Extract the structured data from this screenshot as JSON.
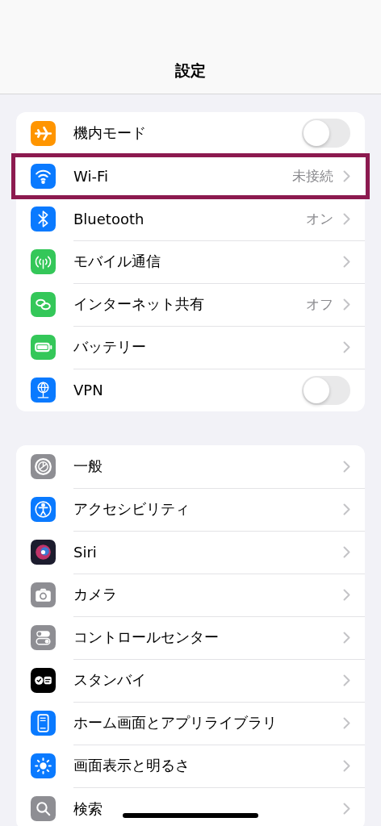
{
  "header": {
    "title": "設定"
  },
  "groups": [
    {
      "rows": [
        {
          "label": "機内モード",
          "kind": "toggle",
          "on": false,
          "highlighted": false,
          "color": "#ff9500"
        },
        {
          "label": "Wi-Fi",
          "kind": "link",
          "value": "未接続",
          "highlighted": true,
          "color": "#0a7aff"
        },
        {
          "label": "Bluetooth",
          "kind": "link",
          "value": "オン",
          "highlighted": false,
          "color": "#0a7aff"
        },
        {
          "label": "モバイル通信",
          "kind": "link",
          "highlighted": false,
          "color": "#34c759"
        },
        {
          "label": "インターネット共有",
          "kind": "link",
          "value": "オフ",
          "highlighted": false,
          "color": "#34c759"
        },
        {
          "label": "バッテリー",
          "kind": "link",
          "highlighted": false,
          "color": "#34c759"
        },
        {
          "label": "VPN",
          "kind": "toggle",
          "on": false,
          "highlighted": false,
          "color": "#0a7aff"
        }
      ]
    },
    {
      "rows": [
        {
          "label": "一般",
          "kind": "link",
          "highlighted": false,
          "color": "#8e8e93"
        },
        {
          "label": "アクセシビリティ",
          "kind": "link",
          "highlighted": false,
          "color": "#0a7aff"
        },
        {
          "label": "Siri",
          "kind": "link",
          "highlighted": false,
          "color": "#1c1c2e"
        },
        {
          "label": "カメラ",
          "kind": "link",
          "highlighted": false,
          "color": "#8e8e93"
        },
        {
          "label": "コントロールセンター",
          "kind": "link",
          "highlighted": false,
          "color": "#8e8e93"
        },
        {
          "label": "スタンバイ",
          "kind": "link",
          "highlighted": false,
          "color": "#000000"
        },
        {
          "label": "ホーム画面とアプリライブラリ",
          "kind": "link",
          "highlighted": false,
          "color": "#0a7aff"
        },
        {
          "label": "画面表示と明るさ",
          "kind": "link",
          "highlighted": false,
          "color": "#0a7aff"
        },
        {
          "label": "検索",
          "kind": "link",
          "highlighted": false,
          "color": "#8e8e93"
        }
      ]
    }
  ]
}
